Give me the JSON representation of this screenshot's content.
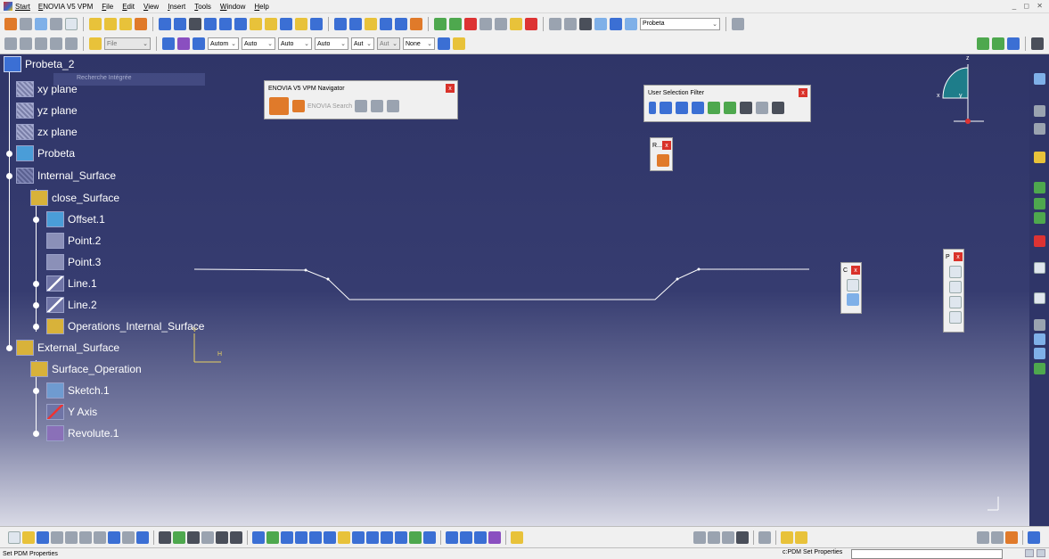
{
  "menubar": {
    "start": "Start",
    "items": [
      "ENOVIA V5 VPM",
      "File",
      "Edit",
      "View",
      "Insert",
      "Tools",
      "Window",
      "Help"
    ]
  },
  "toolbar_top": {
    "part_combo": "Probeta"
  },
  "toolbar_second": {
    "file_combo": "File",
    "combos": [
      "Autom",
      "Auto",
      "Auto",
      "Auto",
      "Aut",
      "Aut",
      "None"
    ]
  },
  "tree": {
    "root": "Probeta_2",
    "ghost_text": "Recherche Intégrée",
    "nodes": [
      {
        "label": "xy plane",
        "icon": "plane-icon"
      },
      {
        "label": "yz plane",
        "icon": "plane-icon"
      },
      {
        "label": "zx plane",
        "icon": "plane-icon"
      },
      {
        "label": "Probeta",
        "icon": "body-icon"
      },
      {
        "label": "Internal_Surface",
        "icon": "geometrical-set-icon"
      },
      {
        "label": "close_Surface",
        "icon": "surface-icon"
      },
      {
        "label": "Offset.1",
        "icon": "offset-icon"
      },
      {
        "label": "Point.2",
        "icon": "point-icon"
      },
      {
        "label": "Point.3",
        "icon": "point-icon"
      },
      {
        "label": "Line.1",
        "icon": "line-icon"
      },
      {
        "label": "Line.2",
        "icon": "line-icon"
      },
      {
        "label": "Operations_Internal_Surface",
        "icon": "surface-icon"
      },
      {
        "label": "External_Surface",
        "icon": "surface-icon"
      },
      {
        "label": "Surface_Operation",
        "icon": "surface-icon"
      },
      {
        "label": "Sketch.1",
        "icon": "sketch-icon"
      },
      {
        "label": "Y Axis",
        "icon": "axis-icon"
      },
      {
        "label": "Revolute.1",
        "icon": "revolute-icon"
      }
    ]
  },
  "windows": {
    "enovia_navigator": {
      "title": "ENOVIA V5 VPM Navigator",
      "search_label": "ENOVIA Search"
    },
    "user_selection_filter": {
      "title": "User Selection Filter"
    },
    "small_toolbar_r": {
      "title": "R..."
    },
    "small_toolbar_c": {
      "title": "C"
    },
    "small_toolbar_p": {
      "title": "P"
    }
  },
  "axes": {
    "h_label": "H",
    "v_label": "V",
    "compass_x": "x",
    "compass_y": "y",
    "compass_z": "z"
  },
  "status": {
    "left": "Set PDM Properties",
    "right": "c:PDM Set Properties",
    "command_input": ""
  },
  "colors": {
    "viewport_top": "#2f3568",
    "viewport_bottom": "#d9dae6",
    "toolbar_bg": "#f0f0f0",
    "close_red": "#d9322a"
  }
}
